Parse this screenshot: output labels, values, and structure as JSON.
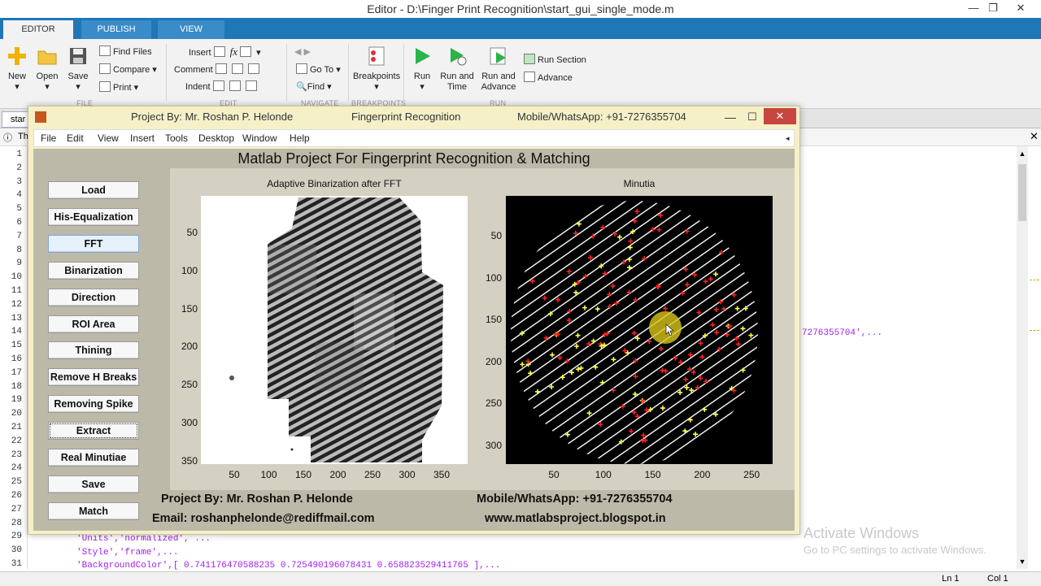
{
  "window": {
    "title": "Editor - D:\\Finger Print Recognition\\start_gui_single_mode.m"
  },
  "ribbon": {
    "tabs": [
      "EDITOR",
      "PUBLISH",
      "VIEW"
    ],
    "file": {
      "new": "New",
      "open": "Open",
      "save": "Save",
      "find_files": "Find Files",
      "compare": "Compare",
      "print": "Print",
      "group": "FILE"
    },
    "edit": {
      "insert": "Insert",
      "comment": "Comment",
      "indent": "Indent",
      "fx": "fx",
      "group": "EDIT"
    },
    "navigate": {
      "goto": "Go To",
      "find": "Find",
      "group": "NAVIGATE"
    },
    "breakpoints": {
      "label": "Breakpoints",
      "group": "BREAKPOINTS"
    },
    "run": {
      "run": "Run",
      "run_time_1": "Run and",
      "run_time_2": "Time",
      "run_adv_1": "Run and",
      "run_adv_2": "Advance",
      "run_section": "Run Section",
      "advance": "Advance",
      "group": "RUN"
    }
  },
  "editor": {
    "tab": "star",
    "info": "Th",
    "line_numbers": [
      "1",
      "2",
      "3",
      "4",
      "5",
      "6",
      "7",
      "8",
      "9",
      "10",
      "11",
      "12",
      "13",
      "14",
      "15",
      "16",
      "17",
      "18",
      "19",
      "20",
      "21",
      "22",
      "23",
      "24",
      "25",
      "26",
      "27",
      "28",
      "29",
      "30",
      "31"
    ],
    "code_right": "7276355704',...",
    "code_29": "'Units','normalized', ...",
    "code_30": "'Style','frame',...",
    "code_31": "'BackgroundColor',[ 0.741176470588235 0.725490196078431 0.658823529411765 ],..."
  },
  "status": {
    "ln": "Ln  1",
    "col": "Col  1"
  },
  "watermark": {
    "line1": "Activate Windows",
    "line2": "Go to PC settings to activate Windows."
  },
  "figure": {
    "title_left": "Project By: Mr. Roshan P. Helonde",
    "title_center": "Fingerprint Recognition",
    "title_right": "Mobile/WhatsApp: +91-7276355704",
    "menu": [
      "File",
      "Edit",
      "View",
      "Insert",
      "Tools",
      "Desktop",
      "Window",
      "Help"
    ],
    "main_title": "Matlab Project For Fingerprint Recognition & Matching",
    "buttons": [
      "Load",
      "His-Equalization",
      "FFT",
      "Binarization",
      "Direction",
      "ROI Area",
      "Thining",
      "Remove H Breaks",
      "Removing Spike",
      "Extract",
      "Real Minutiae",
      "Save",
      "Match"
    ],
    "left_axes": {
      "title": "Adaptive Binarization after FFT",
      "yticks": [
        "50",
        "100",
        "150",
        "200",
        "250",
        "300",
        "350"
      ],
      "xticks": [
        "50",
        "100",
        "150",
        "200",
        "250",
        "300",
        "350"
      ]
    },
    "right_axes": {
      "title": "Minutia",
      "yticks": [
        "50",
        "100",
        "150",
        "200",
        "250",
        "300"
      ],
      "xticks": [
        "50",
        "100",
        "150",
        "200",
        "250"
      ]
    },
    "footer": {
      "project": "Project By:  Mr. Roshan P. Helonde",
      "email": "Email: roshanphelonde@rediffmail.com",
      "mobile": "Mobile/WhatsApp: +91-7276355704",
      "site": "www.matlabsproject.blogspot.in"
    }
  },
  "colors": {
    "ribbon_blue": "#1f77b8",
    "figure_bg": "#f5f0c8",
    "panel_bg": "#bdb9a8",
    "minutia_red": "#ff2020",
    "minutia_yellow": "#ffff40"
  }
}
